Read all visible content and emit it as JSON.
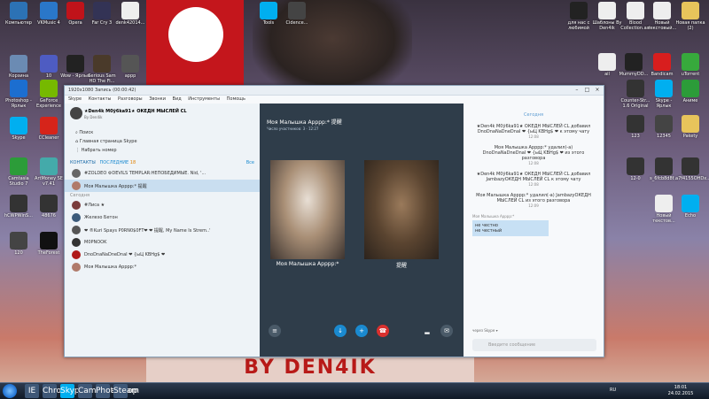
{
  "desktop": {
    "icons": [
      {
        "label": "Компьютер",
        "name": "computer-icon",
        "color": "#2c72b5"
      },
      {
        "label": "VKMusic 4",
        "name": "vkmusic-icon",
        "color": "#2a77c9"
      },
      {
        "label": "Opera",
        "name": "opera-icon",
        "color": "#c0131a"
      },
      {
        "label": "Far Cry 3",
        "name": "farcry-icon",
        "color": "#335"
      },
      {
        "label": "denk42014...",
        "name": "file-icon",
        "color": "#eee"
      },
      {
        "label": "Корзина",
        "name": "trash-icon",
        "color": "#6b8bb3"
      },
      {
        "label": "10",
        "name": "folder-icon",
        "color": "#4e5cc2"
      },
      {
        "label": "Wow - Ярлык",
        "name": "game-icon",
        "color": "#222"
      },
      {
        "label": "Serious Sam HD The Fi...",
        "name": "game-icon",
        "color": "#4a3a2a"
      },
      {
        "label": "аррр",
        "name": "image-icon",
        "color": "#555"
      },
      {
        "label": "Photoshop - Ярлык",
        "name": "photoshop-icon",
        "color": "#1c6ed0"
      },
      {
        "label": "GeForce Experience",
        "name": "geforce-icon",
        "color": "#76b900"
      },
      {
        "label": "Skype",
        "name": "skype-icon",
        "color": "#00aff0"
      },
      {
        "label": "CCleaner",
        "name": "ccleaner-icon",
        "color": "#d6241a"
      },
      {
        "label": "Camtasia Studio 7",
        "name": "camtasia-icon",
        "color": "#2c9c39"
      },
      {
        "label": "ArtMoney SE v7.41",
        "name": "artmoney-icon",
        "color": "#4aa"
      },
      {
        "label": "hCWPWinS...",
        "name": "app-icon",
        "color": "#333"
      },
      {
        "label": "48676",
        "name": "image-icon",
        "color": "#333"
      },
      {
        "label": "120",
        "name": "image-icon",
        "color": "#444"
      },
      {
        "label": "TheForest",
        "name": "game-icon",
        "color": "#111"
      },
      {
        "label": "Tools",
        "name": "skype-icon",
        "color": "#00aff0"
      },
      {
        "label": "Cidence...",
        "name": "image-icon",
        "color": "#444"
      }
    ],
    "right_icons": [
      {
        "label": "для нас с любимой",
        "name": "image-icon",
        "color": "#222"
      },
      {
        "label": "Шаблоны By Den4ik",
        "name": "file-icon",
        "color": "#eee"
      },
      {
        "label": "Blood Collection.asl",
        "name": "file-icon",
        "color": "#eee"
      },
      {
        "label": "Новый текстовый...",
        "name": "file-icon",
        "color": "#eee"
      },
      {
        "label": "Новая папка (2)",
        "name": "folder-icon",
        "color": "#e7c45b"
      },
      {
        "label": "ail",
        "name": "file-icon",
        "color": "#eee"
      },
      {
        "label": "MummyDD...",
        "name": "image-icon",
        "color": "#222"
      },
      {
        "label": "Bandicam",
        "name": "bandicam-icon",
        "color": "#d81e1e"
      },
      {
        "label": "uTorrent",
        "name": "utorrent-icon",
        "color": "#37a93c"
      },
      {
        "label": "Counter-Str... 1.6 Original",
        "name": "game-icon",
        "color": "#333"
      },
      {
        "label": "Skype - Ярлык",
        "name": "skype-icon",
        "color": "#00aff0"
      },
      {
        "label": "Аниме",
        "name": "game-icon",
        "color": "#2c9c39"
      },
      {
        "label": "123",
        "name": "image-icon",
        "color": "#333"
      },
      {
        "label": "12345",
        "name": "image-icon",
        "color": "#444"
      },
      {
        "label": "Pakety",
        "name": "folder-icon",
        "color": "#e7c45b"
      },
      {
        "label": "12-0",
        "name": "image-icon",
        "color": "#333"
      },
      {
        "label": "s_6fcb8d8f...",
        "name": "image-icon",
        "color": "#333"
      },
      {
        "label": "a7f4155OHDx...",
        "name": "image-icon",
        "color": "#333"
      },
      {
        "label": "Новый текстов...",
        "name": "file-icon",
        "color": "#eee"
      },
      {
        "label": "Echo",
        "name": "skype-icon",
        "color": "#00aff0"
      }
    ],
    "wallpaper_text": "BY DEN4IK"
  },
  "window": {
    "title_left": "1920x1080   Запись (00:00:42)",
    "menu": [
      "Skype",
      "Контакты",
      "Разговоры",
      "Звонки",
      "Вид",
      "Инструменты",
      "Помощь"
    ]
  },
  "left": {
    "profile_name": "★Den4k M0ÿ6ka91★ ОКЕДН МЫСЛЕЙ CL",
    "profile_sub": "By Den4ik",
    "search": "Поиск",
    "home": "Главная страница Skype",
    "dial": "Набрать номер",
    "tab_contacts": "КОНТАКТЫ",
    "tab_recent": "ПОСЛЕДНИЕ",
    "recent_count": "18",
    "all": "Все",
    "items": [
      {
        "title": "#ZOLDEO ⚙DEVILS TEMPLAR:НЕПОБЕДИМЫЕ. Nid, '...",
        "color": "#666"
      },
      {
        "title": "Моя Малышка Арррр:* 提醒",
        "color": "#b07a6a"
      },
      {
        "title": "Сегодня",
        "color": ""
      },
      {
        "title": "#Лиса ★",
        "color": "#7a3b3b"
      },
      {
        "title": "Железо Бетон",
        "color": "#3b5a7a"
      },
      {
        "title": "❤ ®Kuri Spays P0RN0$0FT❤ ❤ 提醒, My Name Is Strem..'",
        "color": "#555"
      },
      {
        "title": "M0PNOOK",
        "color": "#333"
      },
      {
        "title": "DnoDnaNaDneDnaI ❤ {ыЦ KBHg$ ❤",
        "color": "#b01818"
      },
      {
        "title": "Моя Малышка Арррр:*",
        "color": "#b07a6a"
      }
    ]
  },
  "center": {
    "call_title": "Моя Малышка Арррр:* 提醒",
    "call_sub": "Число участников: 3 · 12:27",
    "left_label": "Моя Малышка Арррр:*",
    "right_label": "提醒"
  },
  "right": {
    "today": "Сегодня",
    "messages": [
      {
        "text": "★Den4k M0ÿ6ka91★ ОКЕДН МЫСЛЕЙ CL добавил DnoDnaNaDneDnaI ❤ {ыЦ KBHg$ ❤ к этому чату",
        "time": "12:08"
      },
      {
        "text": "Моя Малышка Арррр:* удалил(-а) DnoDnaNaDneDnaI ❤ {ыЦ KBHg$ ❤ из этого разговора",
        "time": "12:08"
      },
      {
        "text": "★Den4k M0ÿ6ka91★ ОКЕДН МЫСЛЕЙ CL добавил JambazyОКЕДН МЫСЛЕЙ CL к этому чату",
        "time": "12:08"
      },
      {
        "text": "Моя Малышка Арррр:* удалил(-а) JambazyОКЕДН МЫСЛЕЙ CL из этого разговора",
        "time": "12:09"
      }
    ],
    "bubble_sender": "Моя Малышка Арррр:*",
    "bubble_lines": [
      "не честно",
      "не честный"
    ],
    "bubble_time": "12:08",
    "via": "через Skype ▾",
    "input_placeholder": "Введите сообщение"
  },
  "taskbar": {
    "apps": [
      "IE",
      "Chrome",
      "Skype",
      "Camtasia",
      "Photoshop",
      "Steam"
    ],
    "lang": "RU",
    "time": "18:01",
    "date": "24.02.2015"
  }
}
